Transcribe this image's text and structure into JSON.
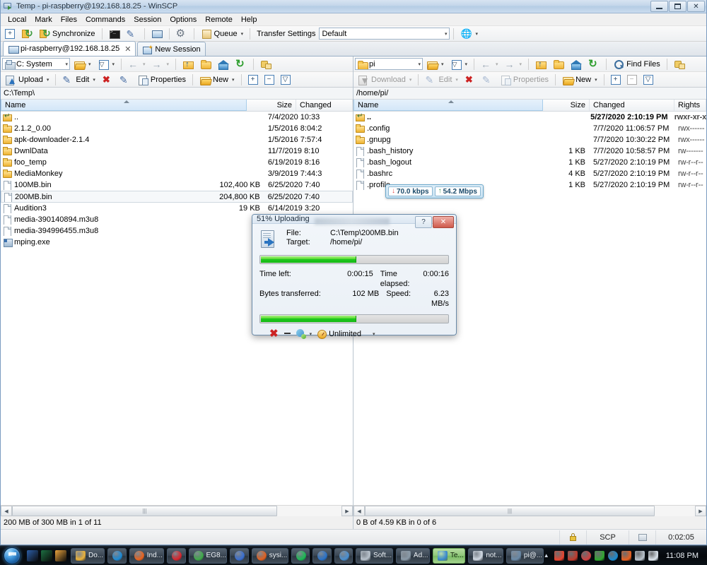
{
  "window": {
    "title": "Temp - pi-raspberry@192.168.18.25 - WinSCP",
    "icon": "winscp-icon",
    "minimize_label": "–",
    "restore_label": "❐",
    "close_label": "✕"
  },
  "menu": {
    "items": [
      "Local",
      "Mark",
      "Files",
      "Commands",
      "Session",
      "Options",
      "Remote",
      "Help"
    ]
  },
  "toolbar": {
    "new_tab_label": "",
    "synchronize_label": "Synchronize",
    "queue_label": "Queue",
    "transfer_settings_label": "Transfer Settings",
    "transfer_settings_value": "Default",
    "caret": "▾"
  },
  "tabs": [
    {
      "label": "pi-raspberry@192.168.18.25",
      "icon": "session-icon",
      "close": "✕",
      "active": true
    },
    {
      "label": "New Session",
      "icon": "new-session-icon",
      "active": false
    }
  ],
  "left_panel": {
    "drive_label": "C: System",
    "path": "C:\\Temp\\",
    "buttons": {
      "upload": "Upload",
      "edit": "Edit",
      "properties": "Properties",
      "new": "New"
    },
    "columns": [
      {
        "label": "Name",
        "align": "left"
      },
      {
        "label": "Size",
        "align": "right"
      },
      {
        "label": "Changed",
        "align": "left"
      }
    ],
    "rows": [
      {
        "icon": "parent-folder-icon",
        "name": "..",
        "size": "",
        "changed": "7/4/2020  10:33",
        "selected": false
      },
      {
        "icon": "folder-icon",
        "name": "2.1.2_0.00",
        "size": "",
        "changed": "1/5/2016  8:04:2",
        "selected": false
      },
      {
        "icon": "folder-icon",
        "name": "apk-downloader-2.1.4",
        "size": "",
        "changed": "1/5/2016  7:57:4",
        "selected": false
      },
      {
        "icon": "folder-icon",
        "name": "DwnlData",
        "size": "",
        "changed": "11/7/2019  8:10",
        "selected": false
      },
      {
        "icon": "folder-icon",
        "name": "foo_temp",
        "size": "",
        "changed": "6/19/2019  8:16",
        "selected": false
      },
      {
        "icon": "folder-icon",
        "name": "MediaMonkey",
        "size": "",
        "changed": "3/9/2019  7:44:3",
        "selected": false
      },
      {
        "icon": "file-icon",
        "name": "100MB.bin",
        "size": "102,400 KB",
        "changed": "6/25/2020  7:40",
        "selected": false
      },
      {
        "icon": "file-icon",
        "name": "200MB.bin",
        "size": "204,800 KB",
        "changed": "6/25/2020  7:40",
        "selected": true
      },
      {
        "icon": "file-icon",
        "name": "Audition3",
        "size": "19 KB",
        "changed": "6/14/2019  3:20",
        "selected": false
      },
      {
        "icon": "file-icon",
        "name": "media-390140894.m3u8",
        "size": "",
        "changed": "",
        "selected": false
      },
      {
        "icon": "file-icon",
        "name": "media-394996455.m3u8",
        "size": "",
        "changed": "",
        "selected": false
      },
      {
        "icon": "exe-icon",
        "name": "mping.exe",
        "size": "",
        "changed": "",
        "selected": false
      }
    ],
    "status": "200 MB of 300 MB in 1 of 11"
  },
  "right_panel": {
    "dir_label": "pi",
    "path": "/home/pi/",
    "buttons": {
      "download": "Download",
      "edit": "Edit",
      "properties": "Properties",
      "new": "New",
      "find_files": "Find Files"
    },
    "columns": [
      {
        "label": "Name",
        "align": "left"
      },
      {
        "label": "Size",
        "align": "right"
      },
      {
        "label": "Changed",
        "align": "left"
      },
      {
        "label": "Rights",
        "align": "left"
      }
    ],
    "rows": [
      {
        "icon": "parent-folder-icon",
        "name": "..",
        "size": "",
        "changed": "5/27/2020 2:10:19 PM",
        "rights": "rwxr-xr-x",
        "bold": true
      },
      {
        "icon": "folder-icon",
        "name": ".config",
        "size": "",
        "changed": "7/7/2020 11:06:57 PM",
        "rights": "rwx------",
        "bold": false
      },
      {
        "icon": "folder-icon",
        "name": ".gnupg",
        "size": "",
        "changed": "7/7/2020 10:30:22 PM",
        "rights": "rwx------",
        "bold": false
      },
      {
        "icon": "file-icon",
        "name": ".bash_history",
        "size": "1 KB",
        "changed": "7/7/2020 10:58:57 PM",
        "rights": "rw-------",
        "bold": false
      },
      {
        "icon": "file-icon",
        "name": ".bash_logout",
        "size": "1 KB",
        "changed": "5/27/2020 2:10:19 PM",
        "rights": "rw-r--r--",
        "bold": false
      },
      {
        "icon": "file-icon",
        "name": ".bashrc",
        "size": "4 KB",
        "changed": "5/27/2020 2:10:19 PM",
        "rights": "rw-r--r--",
        "bold": false
      },
      {
        "icon": "file-icon",
        "name": ".profile",
        "size": "1 KB",
        "changed": "5/27/2020 2:10:19 PM",
        "rights": "rw-r--r--",
        "bold": false
      }
    ],
    "status": "0 B of 4.59 KB in 0 of 6",
    "speed_badges": {
      "download": {
        "arrow": "↓",
        "value": "70.0 kbps"
      },
      "upload": {
        "arrow": "↑",
        "value": "54.2 Mbps"
      }
    }
  },
  "status_bar": {
    "lock_icon": "padlock-icon",
    "protocol": "SCP",
    "network_icon": "network-icon",
    "duration": "0:02:05"
  },
  "upload_dialog": {
    "title": "51% Uploading",
    "help_label": "?",
    "close_label": "✕",
    "file_key": "File:",
    "file_value": "C:\\Temp\\200MB.bin",
    "target_key": "Target:",
    "target_value": "/home/pi/",
    "progress_percent": 51,
    "overall_percent": 51,
    "time_left_key": "Time left:",
    "time_left_value": "0:00:15",
    "time_elapsed_key": "Time elapsed:",
    "time_elapsed_value": "0:00:16",
    "bytes_key": "Bytes transferred:",
    "bytes_value": "102 MB",
    "speed_key": "Speed:",
    "speed_value": "6.23 MB/s",
    "cancel_label": "✖",
    "minimize_label": "_",
    "background_caret": "▾",
    "speed_limit_label": "Unlimited",
    "speed_caret": "▾"
  },
  "taskbar": {
    "start_label": "start-orb",
    "quick_launch": [
      {
        "name": "flashdev-icon",
        "color": "#2c5fa8"
      },
      {
        "name": "excel-icon",
        "color": "#1d6f42"
      },
      {
        "name": "media-icon",
        "color": "#e8a33d"
      }
    ],
    "buttons": [
      {
        "label": "Do...",
        "icon": "folder-icon",
        "color": "#e8b13c",
        "active": false
      },
      {
        "label": "",
        "icon": "ie-icon",
        "color": "#1d8ad4",
        "active": false
      },
      {
        "label": "Ind...",
        "icon": "firefox-icon",
        "color": "#e8631f",
        "active": false
      },
      {
        "label": "",
        "icon": "opera-icon",
        "color": "#d9252d",
        "active": false
      },
      {
        "label": "EG8...",
        "icon": "chrome-icon",
        "color": "#3fa94a",
        "active": false
      },
      {
        "label": "",
        "icon": "browser-icon",
        "color": "#3a6fd0",
        "active": false
      },
      {
        "label": "sysi...",
        "icon": "search-icon",
        "color": "#e06020",
        "active": false
      },
      {
        "label": "",
        "icon": "spotify-icon",
        "color": "#1db954",
        "active": false
      },
      {
        "label": "",
        "icon": "music-icon",
        "color": "#2a72c8",
        "active": false
      },
      {
        "label": "",
        "icon": "disc-icon",
        "color": "#4a8fd0",
        "active": false
      },
      {
        "label": "Soft...",
        "icon": "settings-icon",
        "color": "#b8c2cc",
        "active": false
      },
      {
        "label": "Ad...",
        "icon": "console-icon",
        "color": "#8a9aa8",
        "active": false
      },
      {
        "label": "Te...",
        "icon": "winscp-icon",
        "color": "#3a8ad0",
        "active": true
      },
      {
        "label": "not...",
        "icon": "notepad-icon",
        "color": "#cfd8e2",
        "active": false
      },
      {
        "label": "pi@...",
        "icon": "putty-icon",
        "color": "#6a8aa8",
        "active": false
      }
    ],
    "tray": {
      "arrow": "▲",
      "icons": [
        {
          "name": "avast-icon",
          "color": "#e8432f"
        },
        {
          "name": "vmware-icon",
          "color": "#c0392b"
        },
        {
          "name": "pause-icon",
          "color": "#d04040"
        },
        {
          "name": "green-icon",
          "color": "#2fa82f"
        },
        {
          "name": "target-icon",
          "color": "#1a8ad0"
        },
        {
          "name": "vlc2-icon",
          "color": "#e86020"
        },
        {
          "name": "display-icon",
          "color": "#b8c2cc"
        },
        {
          "name": "volume-icon",
          "color": "#dde6ee"
        }
      ],
      "clock": "11:08 PM"
    }
  }
}
